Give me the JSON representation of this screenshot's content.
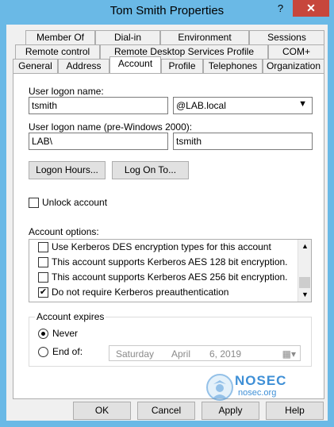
{
  "window": {
    "title": "Tom Smith Properties",
    "help_glyph": "?",
    "close_glyph": "✕"
  },
  "tabs": {
    "row1": [
      "Member Of",
      "Dial-in",
      "Environment",
      "Sessions"
    ],
    "row2": [
      "Remote control",
      "Remote Desktop Services Profile",
      "COM+"
    ],
    "row3": [
      "General",
      "Address",
      "Account",
      "Profile",
      "Telephones",
      "Organization"
    ],
    "active": "Account"
  },
  "account": {
    "logon_name_label": "User logon name:",
    "logon_name_value": "tsmith",
    "domain_value": "@LAB.local",
    "pre2000_label": "User logon name (pre-Windows 2000):",
    "pre2000_domain": "LAB\\",
    "pre2000_user": "tsmith",
    "logon_hours_button": "Logon Hours...",
    "log_on_to_button": "Log On To...",
    "unlock_label": "Unlock account",
    "options_label": "Account options:",
    "options": [
      {
        "label": "Use Kerberos DES encryption types for this account",
        "checked": false
      },
      {
        "label": "This account supports Kerberos AES 128 bit encryption.",
        "checked": false
      },
      {
        "label": "This account supports Kerberos AES 256 bit encryption.",
        "checked": false
      },
      {
        "label": "Do not require Kerberos preauthentication",
        "checked": true
      }
    ],
    "expires": {
      "title": "Account expires",
      "never_label": "Never",
      "end_of_label": "End of:",
      "selected": "Never",
      "date_day": "Saturday",
      "date_month": "April",
      "date_rest": "6, 2019"
    }
  },
  "footer": {
    "ok": "OK",
    "cancel": "Cancel",
    "apply": "Apply",
    "help": "Help"
  },
  "watermark": {
    "brand": "NOSEC",
    "domain": "nosec.org"
  }
}
